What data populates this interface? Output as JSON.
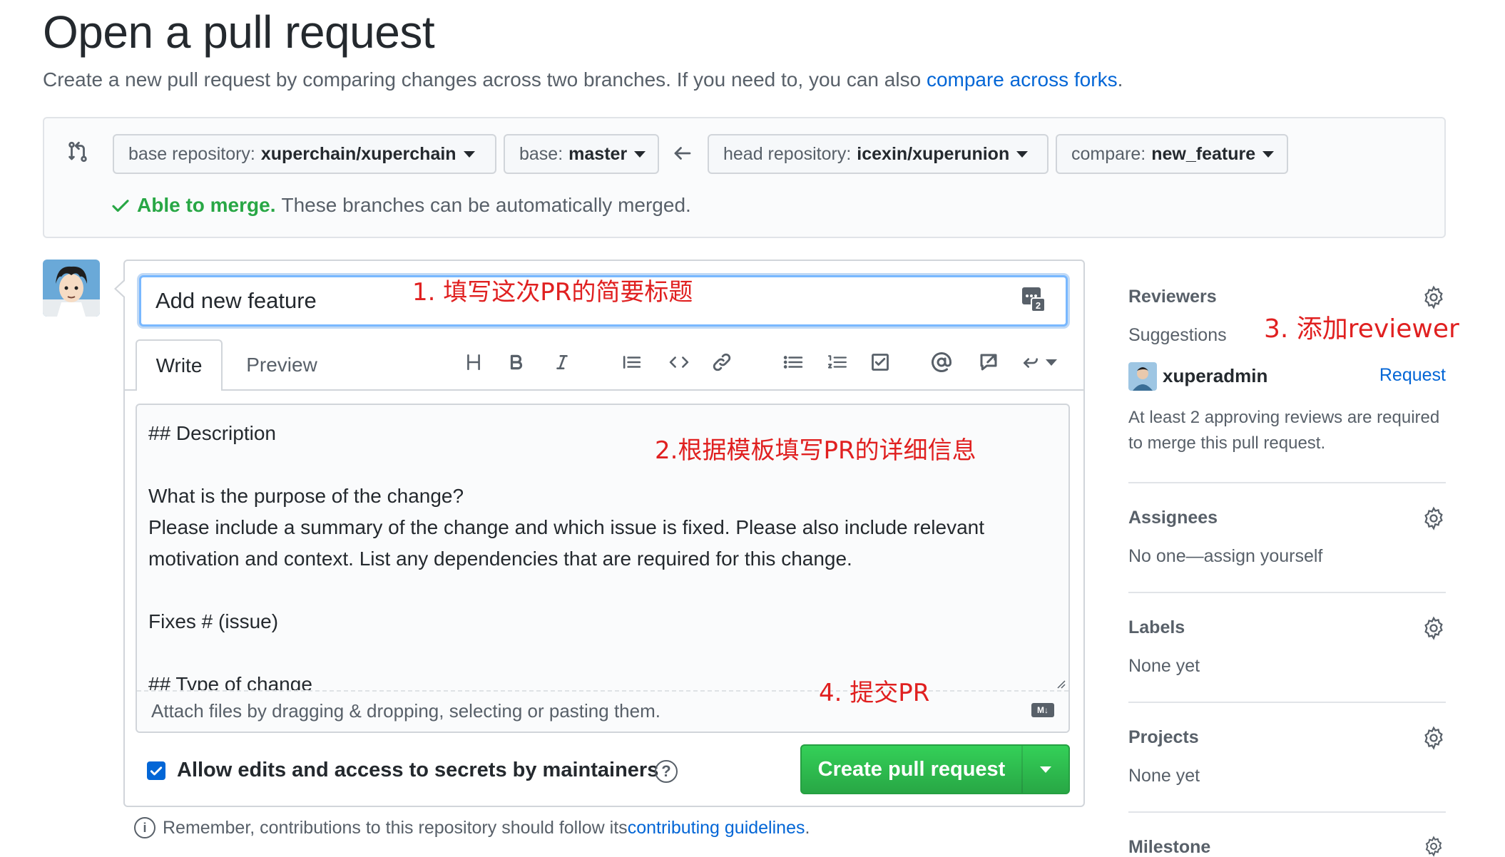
{
  "header": {
    "title": "Open a pull request",
    "subtitle_prefix": "Create a new pull request by comparing changes across two branches. If you need to, you can also ",
    "subtitle_link": "compare across forks",
    "subtitle_suffix": "."
  },
  "compare": {
    "base_repo_label": "base repository:",
    "base_repo_value": "xuperchain/xuperchain",
    "base_label": "base:",
    "base_value": "master",
    "head_repo_label": "head repository:",
    "head_repo_value": "icexin/xuperunion",
    "compare_label": "compare:",
    "compare_value": "new_feature",
    "merge_ok": "Able to merge.",
    "merge_text": "These branches can be automatically merged."
  },
  "form": {
    "title_value": "Add new feature",
    "tabs": {
      "write": "Write",
      "preview": "Preview"
    },
    "toolbar": [
      "heading",
      "bold",
      "italic",
      "quote",
      "code",
      "link",
      "unordered-list",
      "ordered-list",
      "task-list",
      "mention",
      "reference",
      "reply"
    ],
    "body": "## Description\n\nWhat is the purpose of the change?\nPlease include a summary of the change and which issue is fixed. Please also include relevant motivation and context. List any dependencies that are required for this change.\n\nFixes # (issue)\n\n## Type of change",
    "attach_text": "Attach files by dragging & dropping, selecting or pasting them.",
    "allow_edits_label": "Allow edits and access to secrets by maintainers",
    "allow_edits_checked": true,
    "create_button": "Create pull request",
    "remember_prefix": "Remember, contributions to this repository should follow its ",
    "remember_link": "contributing guidelines",
    "remember_suffix": "."
  },
  "sidebar": {
    "reviewers_title": "Reviewers",
    "suggestions_label": "Suggestions",
    "suggested_user": "xuperadmin",
    "request_link": "Request",
    "reviewers_note": "At least 2 approving reviews are required to merge this pull request.",
    "assignees_title": "Assignees",
    "assignees_text": "No one—assign yourself",
    "labels_title": "Labels",
    "labels_text": "None yet",
    "projects_title": "Projects",
    "projects_text": "None yet",
    "milestone_title": "Milestone"
  },
  "annotations": {
    "step1": "1. 填写这次PR的简要标题",
    "step2": "2.根据模板填写PR的详细信息",
    "step3": "3. 添加reviewer",
    "step4": "4. 提交PR"
  },
  "colors": {
    "link": "#0366d6",
    "success": "#28a745",
    "annotation": "#e02020",
    "primary_button": "#2ea44f"
  }
}
